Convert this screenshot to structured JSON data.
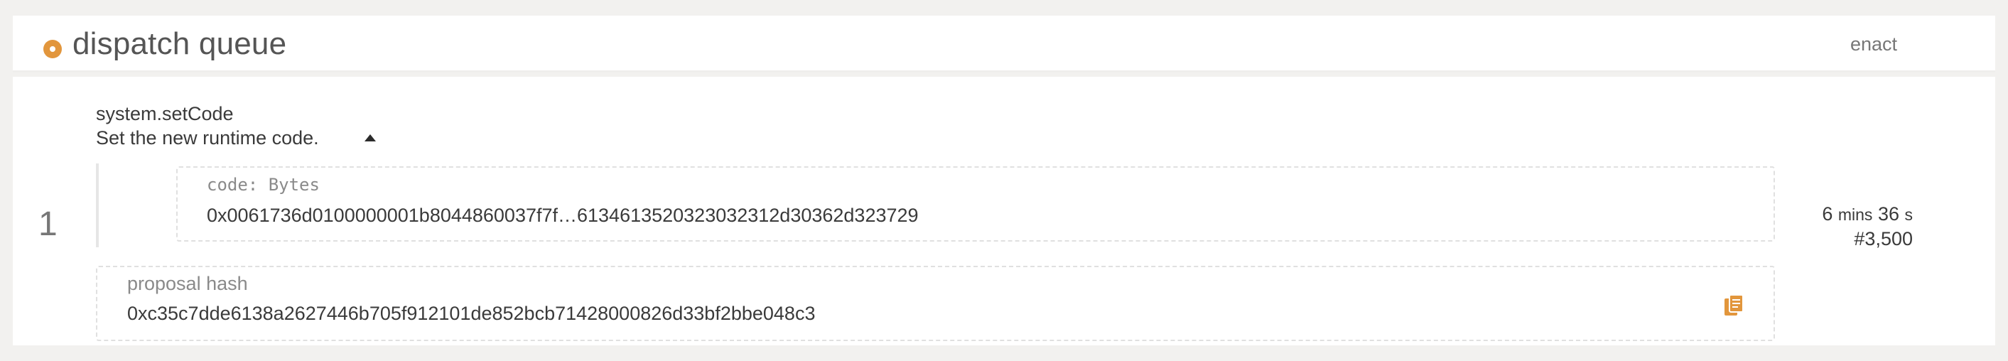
{
  "header": {
    "title": "dispatch queue",
    "action": "enact"
  },
  "row": {
    "index": "1",
    "call": {
      "name": "system.setCode",
      "doc": "Set the new runtime code."
    },
    "param": {
      "label": "code: Bytes",
      "value": "0x0061736d0100000001b8044860037f7f…6134613520323032312d30362d323729"
    },
    "end": {
      "mins_value": "6",
      "mins_unit": "mins",
      "secs_value": "36",
      "secs_unit": "s",
      "block": "#3,500"
    },
    "proposal": {
      "label": "proposal hash",
      "value": "0xc35c7dde6138a2627446b705f912101de852bcb71428000826d33bf2bbe048c3"
    }
  },
  "colors": {
    "accent": "#e2963c",
    "background": "#f2f1ef",
    "card": "#ffffff"
  },
  "icons": {
    "status": "status-dot-icon",
    "expand": "caret-up-icon",
    "copy": "copy-icon"
  }
}
